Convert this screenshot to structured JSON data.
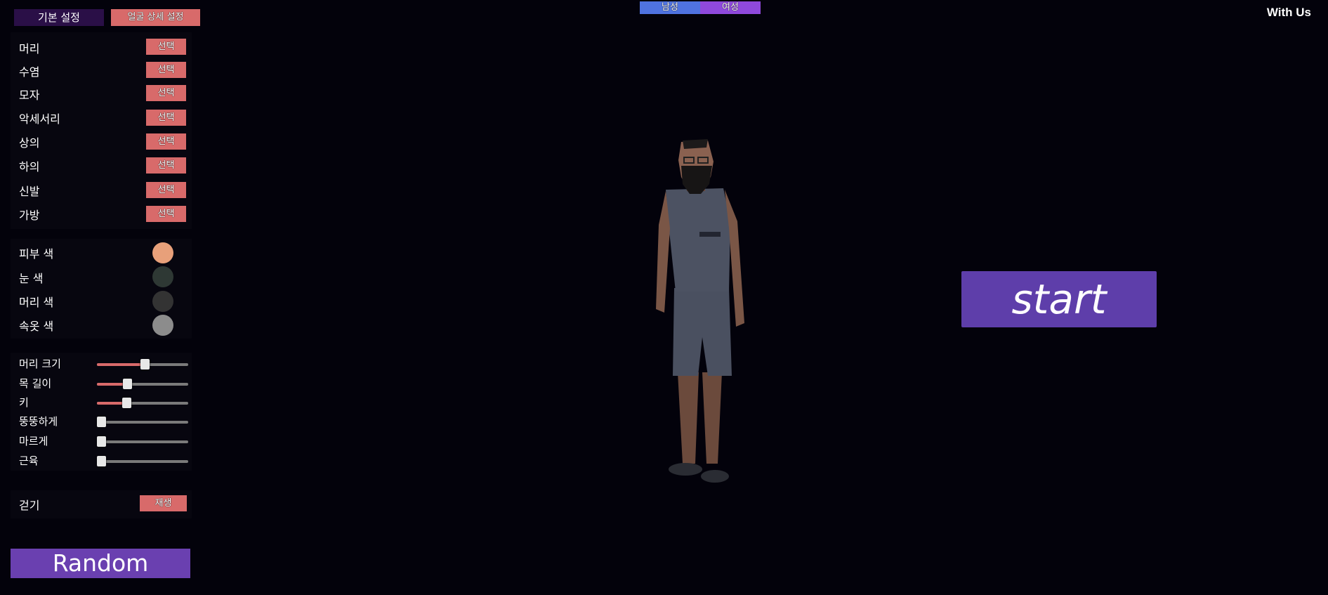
{
  "tabs": {
    "basic": "기본 설정",
    "face_detail": "얼굴 상세 설정"
  },
  "gender": {
    "male": "남성",
    "female": "여성"
  },
  "header": {
    "with_us": "With Us"
  },
  "parts": [
    {
      "label": "머리",
      "button": "선택"
    },
    {
      "label": "수염",
      "button": "선택"
    },
    {
      "label": "모자",
      "button": "선택"
    },
    {
      "label": "악세서리",
      "button": "선택"
    },
    {
      "label": "상의",
      "button": "선택"
    },
    {
      "label": "하의",
      "button": "선택"
    },
    {
      "label": "신발",
      "button": "선택"
    },
    {
      "label": "가방",
      "button": "선택"
    }
  ],
  "colors": [
    {
      "label": "피부 색",
      "value": "#e8a07a"
    },
    {
      "label": "눈 색",
      "value": "#2e3834"
    },
    {
      "label": "머리 색",
      "value": "#333333"
    },
    {
      "label": "속옷 색",
      "value": "#8c8c8c"
    }
  ],
  "sliders": [
    {
      "label": "머리 크기",
      "value": 0.52
    },
    {
      "label": "목 길이",
      "value": 0.33
    },
    {
      "label": "키",
      "value": 0.32
    },
    {
      "label": "뚱뚱하게",
      "value": 0.0
    },
    {
      "label": "마르게",
      "value": 0.0
    },
    {
      "label": "근육",
      "value": 0.0
    }
  ],
  "animation": {
    "label": "걷기",
    "button": "재생"
  },
  "random_button": "Random",
  "start_button": "start"
}
